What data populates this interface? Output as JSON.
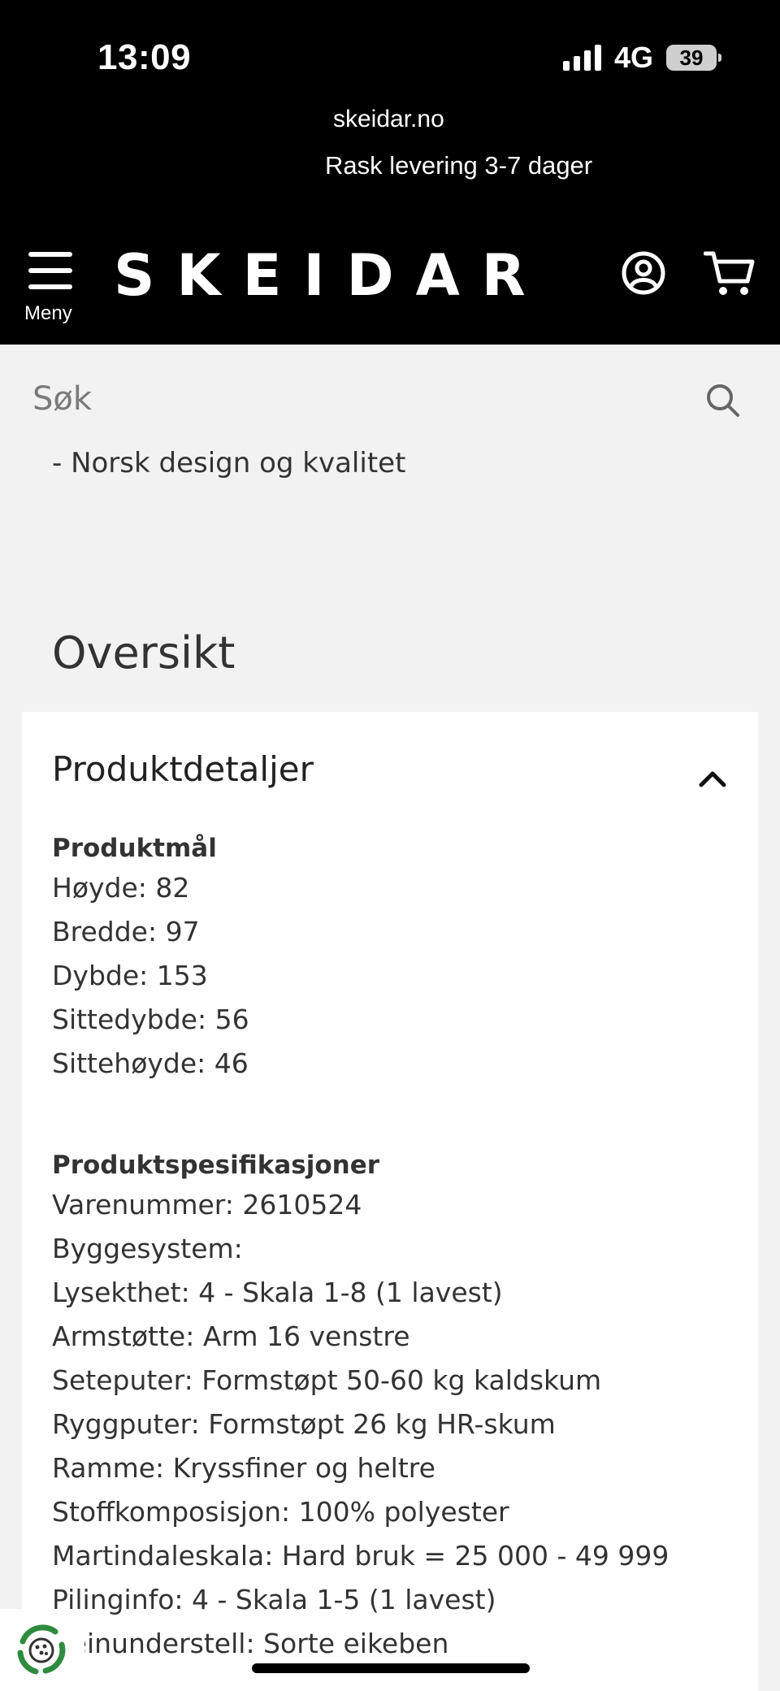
{
  "status": {
    "time": "13:09",
    "network": "4G",
    "battery": "39"
  },
  "browser": {
    "url": "skeidar.no"
  },
  "promo": "Rask levering 3-7 dager",
  "header": {
    "menu_label": "Meny",
    "logo": "SKEIDAR"
  },
  "search": {
    "placeholder": "Søk"
  },
  "tagline": "- Norsk design og kvalitet",
  "section_title": "Oversikt",
  "details": {
    "title": "Produktdetaljer",
    "dimensions": {
      "heading": "Produktmål",
      "lines": [
        "Høyde: 82",
        "Bredde: 97",
        "Dybde: 153",
        "Sittedybde: 56",
        "Sittehøyde: 46"
      ]
    },
    "specs": {
      "heading": "Produktspesifikasjoner",
      "lines": [
        "Varenummer: 2610524",
        "Byggesystem:",
        "Lysekthet: 4 - Skala 1-8 (1 lavest)",
        "Armstøtte: Arm 16 venstre",
        "Seteputer: Formstøpt 50-60 kg kaldskum",
        "Ryggputer: Formstøpt 26 kg HR-skum",
        "Ramme: Kryssfiner og heltre",
        "Stoffkomposisjon: 100% polyester",
        "Martindaleskala: Hard bruk = 25 000 - 49 999",
        "Pilinginfo: 4 - Skala 1-5 (1 lavest)",
        "Beinunderstell: Sorte eikeben"
      ]
    }
  },
  "icons": {
    "menu": "hamburger-icon",
    "account": "user-icon",
    "cart": "cart-icon",
    "search": "search-icon",
    "collapse": "chevron-up-icon",
    "recycle": "recycle-icon"
  },
  "colors": {
    "header_bg": "#000000",
    "page_bg": "#f2f2f2",
    "card_bg": "#ffffff",
    "recycle_green": "#2e8b3e"
  }
}
